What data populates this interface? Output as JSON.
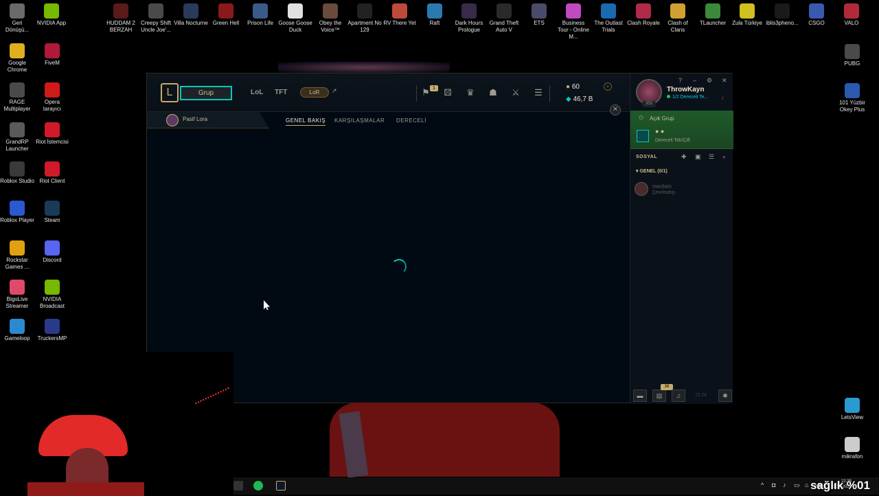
{
  "desktop": {
    "top_icons": [
      {
        "label": "Geri Dönüşü...",
        "color": "#6a6a6a"
      },
      {
        "label": "NVIDIA App",
        "color": "#76b900"
      },
      {
        "label": "HUDDAM 2 BERZAH",
        "color": "#5a1a1a"
      },
      {
        "label": "Creepy Shift Uncle Joe'...",
        "color": "#4a4a4a"
      },
      {
        "label": "Villa Nocturne",
        "color": "#2a3a5a"
      },
      {
        "label": "Green Hell",
        "color": "#8a1a1a"
      },
      {
        "label": "Prison Life",
        "color": "#3a5a8a"
      },
      {
        "label": "Goose Goose Duck",
        "color": "#e0e0e0"
      },
      {
        "label": "Obey the Voice™",
        "color": "#6a4a3a"
      },
      {
        "label": "Apartment No 129",
        "color": "#222222"
      },
      {
        "label": "RV There Yet",
        "color": "#c04a3a"
      },
      {
        "label": "Raft",
        "color": "#2a7ab0"
      },
      {
        "label": "Dark Hours Prologue",
        "color": "#3a2a4a"
      },
      {
        "label": "Grand Theft Auto V",
        "color": "#2a2a2a"
      },
      {
        "label": "ETS",
        "color": "#4a4a6a"
      },
      {
        "label": "Business Tour - Online M...",
        "color": "#c04ac0"
      },
      {
        "label": "The Outlast Trials",
        "color": "#1a6ab0"
      },
      {
        "label": "Clash Royale",
        "color": "#b02a4a"
      },
      {
        "label": "Clash of Clans",
        "color": "#d0a030"
      },
      {
        "label": "TLauncher",
        "color": "#3a8a3a"
      },
      {
        "label": "Zula Türkiye",
        "color": "#d0c020"
      },
      {
        "label": "iblis3pheno...",
        "color": "#1a1a1a"
      },
      {
        "label": "CSGO",
        "color": "#3a5ab0"
      },
      {
        "label": "VALO",
        "color": "#b02a3a"
      }
    ],
    "left_icons": [
      {
        "label": "Google Chrome",
        "color": "#e0b020"
      },
      {
        "label": "FiveM",
        "color": "#b01a3a"
      },
      {
        "label": "RAGE Multiplayer",
        "color": "#4a4a4a"
      },
      {
        "label": "Opera tarayıcı",
        "color": "#d01a1a"
      },
      {
        "label": "GrandRP Launcher",
        "color": "#5a5a5a"
      },
      {
        "label": "Riot İstemcisi",
        "color": "#d01a2a"
      },
      {
        "label": "Roblox Studio",
        "color": "#3a3a3a"
      },
      {
        "label": "Riot Client",
        "color": "#d01a2a"
      },
      {
        "label": "Roblox Player",
        "color": "#2a5ad0"
      },
      {
        "label": "Steam",
        "color": "#1a3a5a"
      },
      {
        "label": "Rockstar Games ...",
        "color": "#e0a010"
      },
      {
        "label": "Discord",
        "color": "#5865f2"
      },
      {
        "label": "BigoLive Streamer",
        "color": "#e04a6a"
      },
      {
        "label": "NVIDIA Broadcast",
        "color": "#76b900"
      },
      {
        "label": "Gameloop",
        "color": "#2a8ad0"
      },
      {
        "label": "TruckersMP",
        "color": "#2a3a8a"
      }
    ],
    "right_icons": [
      {
        "label": "PUBG",
        "color": "#4a4a4a"
      },
      {
        "label": "101 Yüzbir Okey Plus",
        "color": "#2a5ab0"
      },
      {
        "label": "LetsView",
        "color": "#2a9ad0"
      },
      {
        "label": "mikrafon",
        "color": "#cccccc"
      }
    ]
  },
  "client": {
    "play_button": "Grup",
    "tabs": {
      "lol": "LoL",
      "tft": "TFT",
      "lor": "LoR",
      "external": "↗"
    },
    "store_badge": "1",
    "rp": "60",
    "be": "46,7 B",
    "pass_tab": "Pasif Lora",
    "subtabs": [
      "GENEL BAKIŞ",
      "KARŞILAŞMALAR",
      "DERECELİ"
    ],
    "profile": {
      "name": "ThrowKayn",
      "level": "353",
      "status": "1/2 Dereceli Te..."
    },
    "window_controls": {
      "help": "?",
      "min": "–",
      "settings": "⚙",
      "close": "✕"
    },
    "open_group": {
      "title": "Açık Grup",
      "mode": "Dereceli Tek/Çift"
    },
    "social": {
      "title": "SOSYAL",
      "group": "GENEL (0/1)",
      "friend": {
        "name": "merilein",
        "status": "Çevrimdışı"
      }
    },
    "chat_badge": "36",
    "version": "15.08"
  },
  "taskbar": {
    "clock": "22:35",
    "date": "31.12.2026"
  },
  "overlay_text": "sağlık %01"
}
